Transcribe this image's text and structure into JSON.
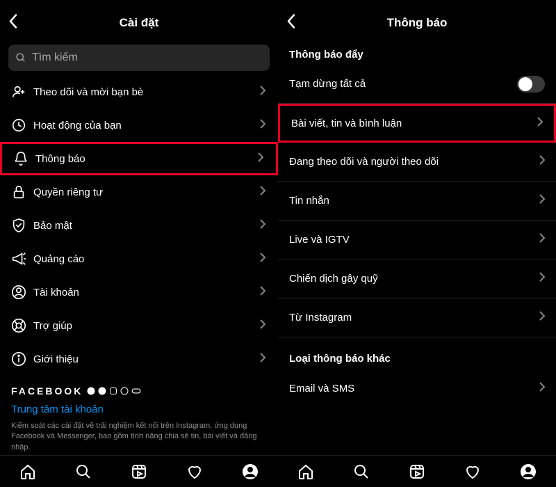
{
  "left": {
    "title": "Cài đặt",
    "search_placeholder": "Tìm kiếm",
    "items": [
      {
        "icon": "user-plus-icon",
        "label": "Theo dõi và mời bạn bè"
      },
      {
        "icon": "clock-icon",
        "label": "Hoạt động của bạn"
      },
      {
        "icon": "bell-icon",
        "label": "Thông báo",
        "highlight": true
      },
      {
        "icon": "lock-icon",
        "label": "Quyền riêng tư"
      },
      {
        "icon": "shield-icon",
        "label": "Bảo mật"
      },
      {
        "icon": "megaphone-icon",
        "label": "Quảng cáo"
      },
      {
        "icon": "account-icon",
        "label": "Tài khoản"
      },
      {
        "icon": "help-icon",
        "label": "Trợ giúp"
      },
      {
        "icon": "info-icon",
        "label": "Giới thiệu"
      }
    ],
    "footer_brand": "FACEBOOK",
    "footer_link": "Trung tâm tài khoản",
    "footer_desc": "Kiểm soát các cài đặt về trải nghiệm kết nối trên Instagram, ứng dụng Facebook và Messenger, bao gồm tính năng chia sẻ tin, bài viết và đăng nhập."
  },
  "right": {
    "title": "Thông báo",
    "section1": "Thông báo đẩy",
    "pause_all": "Tạm dừng tất cả",
    "items": [
      {
        "label": "Bài viết, tin và bình luận",
        "highlight": true
      },
      {
        "label": "Đang theo dõi và người theo dõi"
      },
      {
        "label": "Tin nhắn"
      },
      {
        "label": "Live và IGTV"
      },
      {
        "label": "Chiến dịch gây quỹ"
      },
      {
        "label": "Từ Instagram"
      }
    ],
    "section2": "Loại thông báo khác",
    "email_sms": "Email và SMS"
  }
}
